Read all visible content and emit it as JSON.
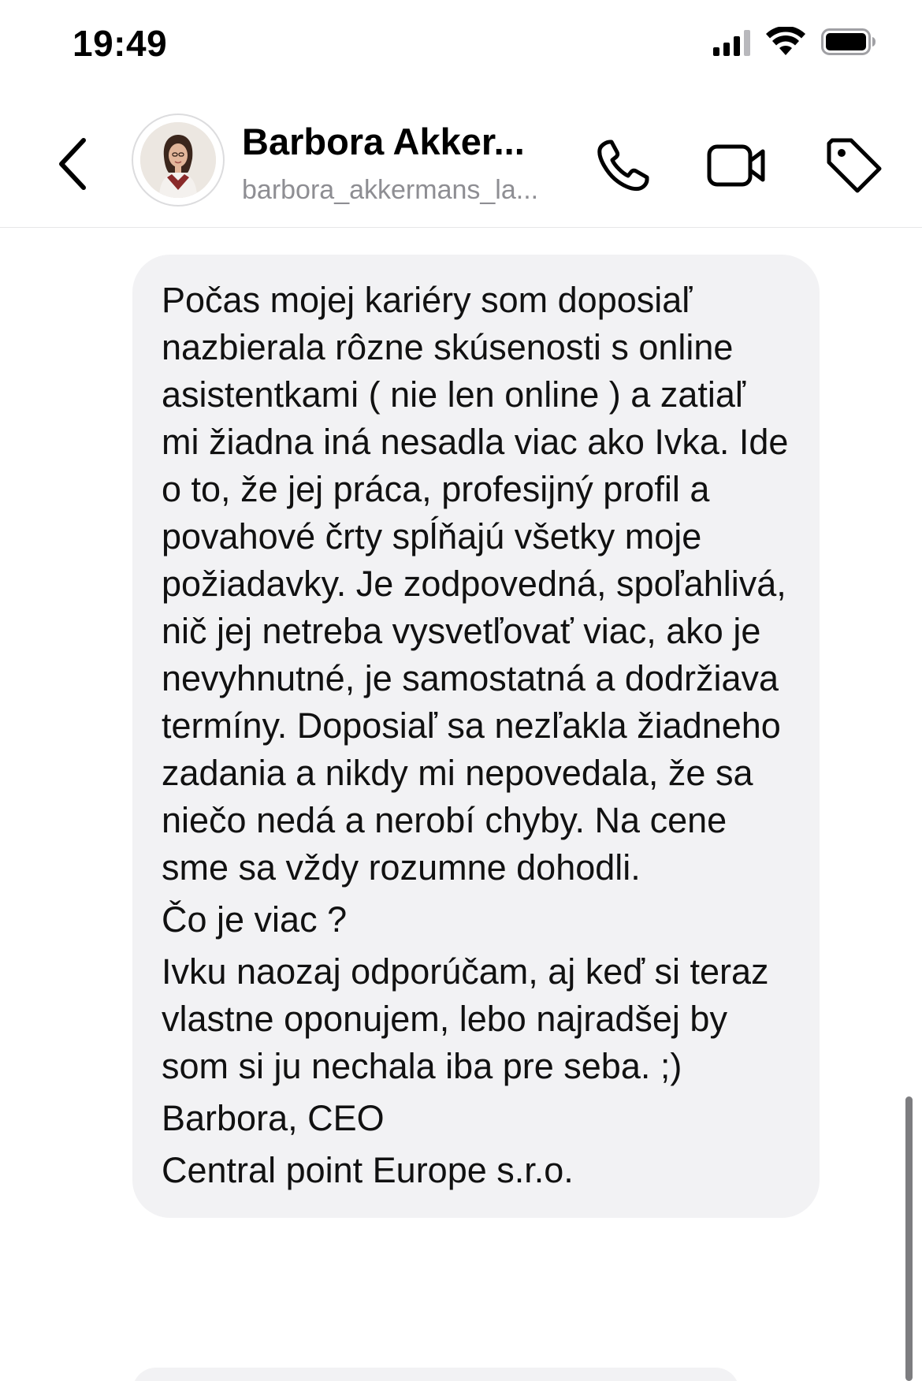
{
  "status_bar": {
    "time": "19:49"
  },
  "header": {
    "contact_name": "Barbora Akker...",
    "contact_handle": "barbora_akkermans_la...",
    "icons": {
      "back": "chevron-left-icon",
      "call": "phone-icon",
      "video": "video-camera-icon",
      "tag": "tag-icon"
    }
  },
  "message": {
    "paragraphs": [
      "Počas mojej kariéry som doposiaľ nazbierala rôzne skúsenosti s online asistentkami ( nie len online ) a zatiaľ mi žiadna iná nesadla viac ako Ivka. Ide o to, že jej práca, profesijný profil a povahové črty spĺňajú všetky moje požiadavky. Je zodpovedná, spoľahlivá, nič jej netreba vysvetľovať viac, ako je nevyhnutné, je samostatná a dodržiava termíny. Doposiaľ sa nezľakla žiadneho zadania a nikdy mi nepovedala, že sa niečo nedá a nerobí chyby. Na cene sme sa vždy rozumne dohodli.",
      "Čo je viac ?",
      "Ivku naozaj odporúčam, aj keď si teraz vlastne oponujem, lebo najradšej by som si ju nechala iba pre seba. ;)",
      "Barbora, CEO",
      "Central point Europe s.r.o."
    ]
  }
}
